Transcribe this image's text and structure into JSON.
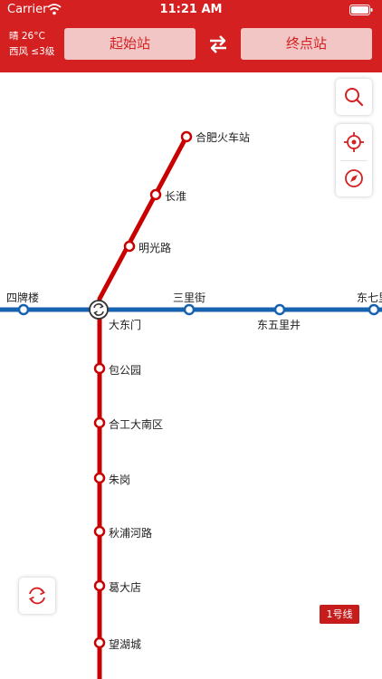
{
  "status_bar": {
    "carrier": "Carrier",
    "time": "11:21 AM"
  },
  "weather": {
    "line1": "晴 26°C",
    "line2": "西风 ≤3级"
  },
  "route": {
    "start_label": "起始站",
    "end_label": "终点站"
  },
  "stations": {
    "hefei_station": "合肥火车站",
    "changhuai": "长淮",
    "mingguang": "明光路",
    "sipailou": "四牌楼",
    "sanlijie": "三里街",
    "dongqi": "东七里",
    "dadongmen": "大东门",
    "dongwulijing": "东五里井",
    "baogongyuan": "包公园",
    "hegong": "合工大南区",
    "zhugang": "朱岗",
    "qiupu": "秋浦河路",
    "gedadian": "葛大店",
    "wanghucheng": "望湖城"
  },
  "line_badge": "1号线",
  "colors": {
    "header": "#d42020",
    "line1": "#c90000",
    "line2": "#1762b0"
  },
  "icons": [
    "wifi-icon",
    "battery-icon",
    "swap-icon",
    "search-icon",
    "locate-icon",
    "compass-icon",
    "refresh-icon"
  ]
}
